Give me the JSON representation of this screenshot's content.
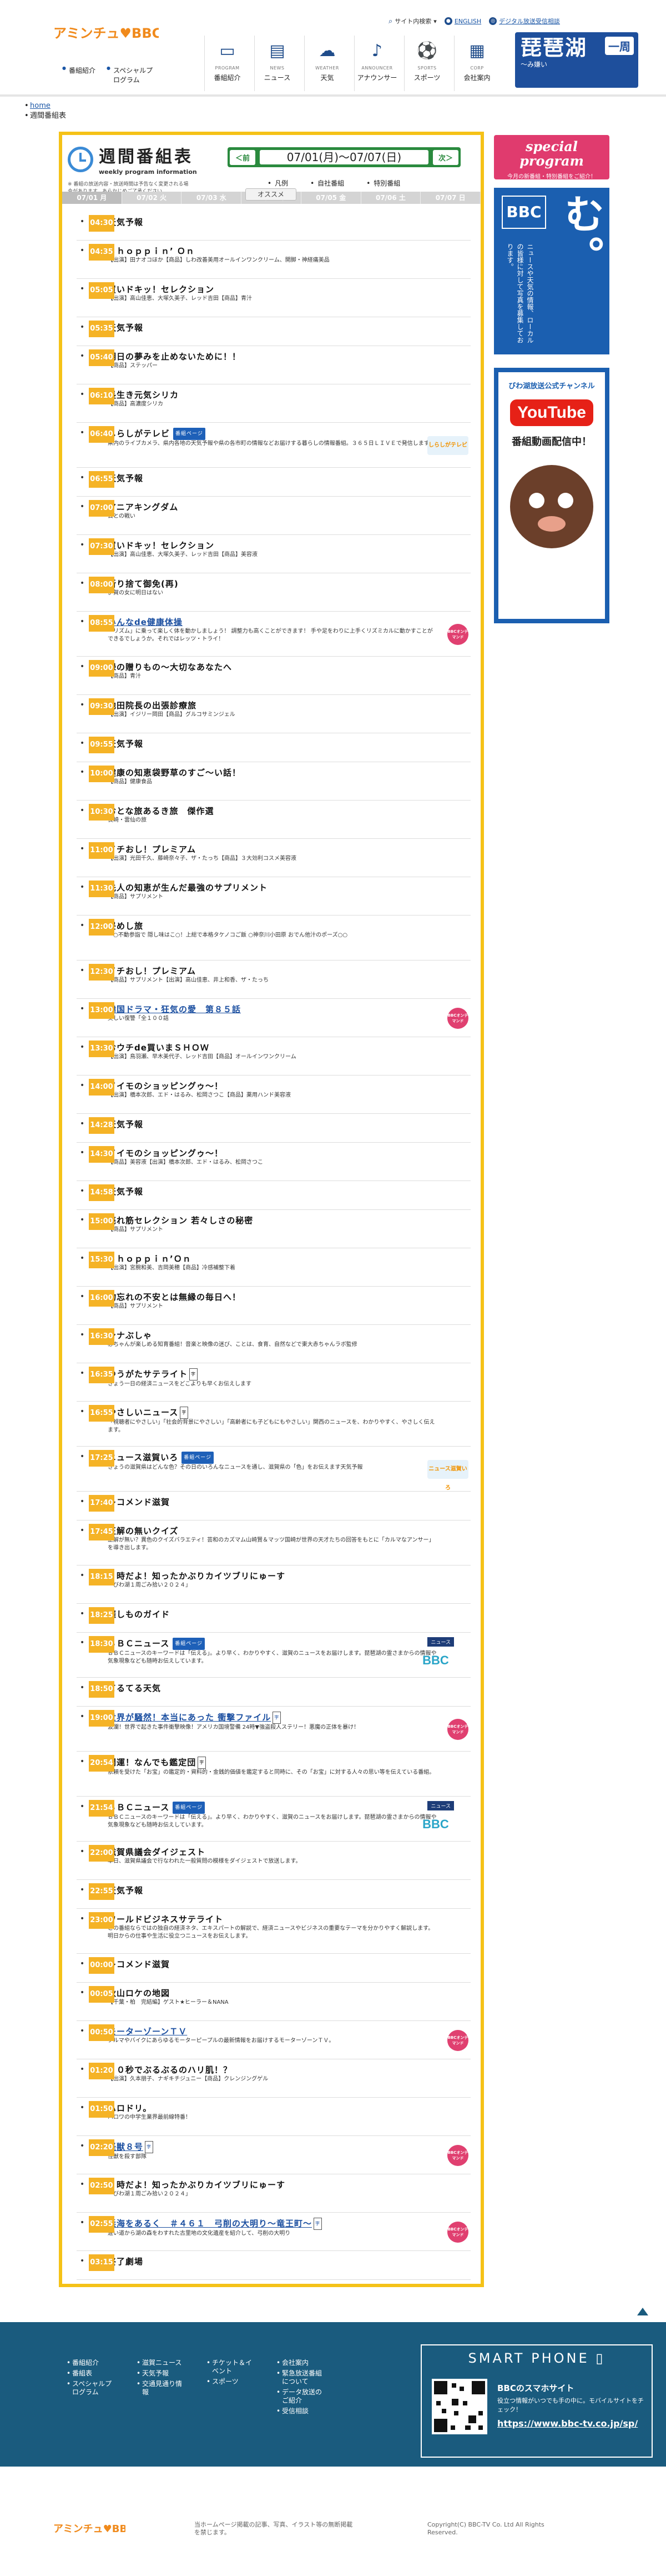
{
  "header": {
    "logo_text": "アミンチュ♥BBC",
    "util": {
      "site_search": "サイト内検索",
      "english": "ENGLISH",
      "digital": "デジタル放送受信相談"
    },
    "sub_links": [
      "番組紹介",
      "スペシャルプログラム"
    ],
    "nav": [
      {
        "en": "PROGRAM",
        "jp": "番組紹介",
        "icon": "tv-icon"
      },
      {
        "en": "NEWS",
        "jp": "ニュース",
        "icon": "news-icon"
      },
      {
        "en": "WEATHER",
        "jp": "天気",
        "icon": "weather-icon"
      },
      {
        "en": "ANNOUNCER",
        "jp": "アナウンサー",
        "icon": "microphone-icon"
      },
      {
        "en": "SPORTS",
        "jp": "スポーツ",
        "icon": "sports-icon"
      },
      {
        "en": "CORP",
        "jp": "会社案内",
        "icon": "building-icon"
      }
    ],
    "banner": {
      "title": "琵琶湖",
      "badge": "一周",
      "sub": "〜み嫌い"
    }
  },
  "breadcrumb": {
    "home": "home",
    "current": "週間番組表"
  },
  "schedule": {
    "title_jp": "週間番組表",
    "title_en": "weekly program information",
    "note": "※ 番組の放送内容・放送時間は予告なく変更される場合があります。あらかじめご了承ください。",
    "prev": "＜前",
    "next": "次＞",
    "range": "07/01(月)〜07/07(日)",
    "legend": [
      "凡例",
      "自社番組",
      "特別番組"
    ],
    "recommend": "オススメ",
    "days": [
      "07/01 月",
      "07/02 火",
      "07/03 水",
      "07/04 木",
      "07/05 金",
      "07/06 土",
      "07/07 日"
    ],
    "page_badge": "番組ページ",
    "news_badge": "ニュース",
    "ondemand": "BBCオンデマンド",
    "programs": [
      {
        "time": "04:30",
        "title": "天気予報",
        "desc": ""
      },
      {
        "time": "04:35",
        "title": "Ｓｈｏｐｐｉｎ’ Ｏｎ",
        "desc": "【出演】田ナオコほか【商品】しわ改善美用オールインワンクリーム、開脚・神経痛美品"
      },
      {
        "time": "05:05",
        "title": "買いドキッ！セレクション",
        "desc": "【出演】高山佳恵、大塚久美子、レッド吉田【商品】青汁"
      },
      {
        "time": "05:35",
        "title": "天気予報",
        "desc": ""
      },
      {
        "time": "05:40",
        "title": "明日の夢みを止めないために！！",
        "desc": "【商品】ステッパー"
      },
      {
        "time": "06:10",
        "title": "長生き元気シリカ",
        "desc": "【商品】高濃度シリカ"
      },
      {
        "time": "06:40",
        "title": "しらしがテレビ",
        "desc": "県内のライブカメラ、県内各地の天気予報や県の各市町の情報などお届けする暮らしの情報番組。３６５日ＬＩＶＥで発信します。",
        "page": true
      },
      {
        "time": "06:55",
        "title": "天気予報",
        "desc": ""
      },
      {
        "time": "07:00",
        "title": "アニアキングダム",
        "desc": "去との戦い"
      },
      {
        "time": "07:30",
        "title": "買いドキッ！セレクション",
        "desc": "【出演】高山佳恵、大塚久美子、レッド吉田【商品】美容液"
      },
      {
        "time": "08:00",
        "title": "新り捨て御免(再)",
        "desc": "伊賀の女に明日はない"
      },
      {
        "time": "08:55",
        "title": "みんなde健康体操",
        "desc": "「リズム」に乗って楽しく体を動かしましょう！ 調整力も高くことができます！ 手や足をわりに上手くリズミカルに動かすことができるでしょうか。それではレッツ・トライ！",
        "link": true,
        "ondemand": true
      },
      {
        "time": "09:00",
        "title": "緑の贈りもの〜大切なあなたへ",
        "desc": "【商品】青汁"
      },
      {
        "time": "09:30",
        "title": "池田院長の出張診療旅",
        "desc": "【出演】イジリー岡田【商品】グルコサミンジェル"
      },
      {
        "time": "09:55",
        "title": "天気予報",
        "desc": ""
      },
      {
        "time": "10:00",
        "title": "健康の知恵袋野草のすご〜い話！",
        "desc": "【商品】健康食品"
      },
      {
        "time": "10:30",
        "title": "おとな旅あるき旅　傑作選",
        "desc": "長崎・雲仙の旅"
      },
      {
        "time": "11:00",
        "title": "イチおし！プレミアム",
        "desc": "【出演】光田千久、藤崎奈々子、ザ・たっち【商品】３大効利コスメ美容液"
      },
      {
        "time": "11:30",
        "title": "先人の知恵が生んだ最強のサプリメント",
        "desc": "【商品】サプリメント"
      },
      {
        "time": "12:00",
        "title": "昼めし旅",
        "desc": "「○不動参詣で 隠し味はこ○！上総で本格タケノコご飯 ○神奈川小田原 おでん他汁のポーズ○○"
      },
      {
        "time": "12:30",
        "title": "イチおし！プレミアム",
        "desc": "【商品】サプリメント【出演】高山佳恵、井上和香、ザ・たっち"
      },
      {
        "time": "13:00",
        "title": "韓国ドラマ・狂気の愛　第８５話",
        "desc": "美しい復讐「全１００話",
        "link": true,
        "ondemand": true
      },
      {
        "time": "13:30",
        "title": "おウチde買いまＳＨＯＷ",
        "desc": "【出演】鳥羽瀬、早木美代子、レッド吉田【商品】オールインワンクリーム"
      },
      {
        "time": "14:00",
        "title": "イイモのショッピングゥ〜！",
        "desc": "【出演】橋本次郎、エド・はるみ、松岡さつこ【商品】薬用ハンド美容液"
      },
      {
        "time": "14:28",
        "title": "天気予報",
        "desc": ""
      },
      {
        "time": "14:30",
        "title": "イイモのショッピングゥ〜！",
        "desc": "【商品】美容液【出演】橋本次郎、エド・はるみ、松岡さつこ"
      },
      {
        "time": "14:58",
        "title": "天気予報",
        "desc": ""
      },
      {
        "time": "15:00",
        "title": "売れ筋セレクション 若々しさの秘密",
        "desc": "【商品】サプリメント"
      },
      {
        "time": "15:30",
        "title": "Ｓｈｏｐｐｉｎ’Ｏｎ",
        "desc": "【出演】宮腕和美、吉岡美穂【商品】冷感補整下着"
      },
      {
        "time": "16:00",
        "title": "物忘れの不安とは無縁の毎日へ！",
        "desc": "【商品】サプリメント"
      },
      {
        "time": "16:30",
        "title": "シナぶしゃ",
        "desc": "赤ちゃんが楽しめる知育番組！音楽と映像の迷び、ことは、食育、自然などで東大赤ちゃんラボ監修"
      },
      {
        "time": "16:35",
        "title": "ゆうがたサテライト",
        "desc": "きょう一日の経済ニュースをどこよりも早くお伝えします",
        "small": "字"
      },
      {
        "time": "16:55",
        "title": "やさしいニュース",
        "desc": "「視聴者にやさしい」「社会的背景にやさしい」「高齢者にも子どもにもやさしい」関西のニュースを、わかりやすく、やさしく伝えます。",
        "small": "字"
      },
      {
        "time": "17:25",
        "title": "ニュース滋賀いろ",
        "desc": "きょうの滋賀県はどんな色？その日のいろんなニュースを通し、滋賀県の「色」をお伝えます天気予報",
        "page": true,
        "thumb": "ニュース滋賀いろ"
      },
      {
        "time": "17:40",
        "title": "レコメンド滋賀",
        "desc": ""
      },
      {
        "time": "17:45",
        "title": "正解の無いクイズ",
        "desc": "正解が無い？異色のクイズバラエティ！芸和のカズマム山崎賢＆マッツ国崎が世界の天才たちの回答をもとに「カルマなアンサー」を導き出します。"
      },
      {
        "time": "18:15",
        "title": "６時だよ！知ったかぶりカイツブリにゅーす",
        "desc": "「びわ湖１周ごみ拾い２０２４」"
      },
      {
        "time": "18:25",
        "title": "催しものガイド",
        "desc": ""
      },
      {
        "time": "18:30",
        "title": "ＢＢＣニュース",
        "desc": "ＢＢＣニュースのキーワードは「伝える」。より早く、わかりやすく、滋賀のニュースをお届けします。琵琶湖の霊さまからの情報や気象現象なども随時お伝えしています。",
        "page": true,
        "news": true,
        "bbc": true
      },
      {
        "time": "18:50",
        "title": "てるてる天気",
        "desc": ""
      },
      {
        "time": "19:00",
        "title": "世界が騒然！本当にあった 衝撃ファイル",
        "desc": "波瀾！世界で起きた事件衝撃映像！アメリカ国境警備 24時▼強盗殺人ステリー！悪魔の正体を暴け！",
        "link": true,
        "small": "字",
        "ondemand": true
      },
      {
        "time": "20:54",
        "title": "開運！なんでも鑑定団",
        "desc": "依頼を受けた「お宝」の鑑定的・資料的・金銭的価値を鑑定すると同時に、その「お宝」に対する人々の思い等を伝えている番組。",
        "small": "字"
      },
      {
        "time": "21:54",
        "title": "ＢＢＣニュース",
        "desc": "ＢＢＣニュースのキーワードは「伝える」。より早く、わかりやすく、滋賀のニュースをお届けします。琵琶湖の霊さまからの情報や気象現象なども随時お伝えしています。",
        "page": true,
        "news": true,
        "bbc": true
      },
      {
        "time": "22:00",
        "title": "滋賀県議会ダイジェスト",
        "desc": "本日、滋賀県議会で行なわれた一般質問の模様をダイジェストで放送します。"
      },
      {
        "time": "22:55",
        "title": "天気予報",
        "desc": ""
      },
      {
        "time": "23:00",
        "title": "ワールドビジネスサテライト",
        "desc": "この番組ならではの独自の経済ネタ、エキスパートの解説で、経済ニュースやビジネスの重要なテーマを分かりやすく解説します。明日からの仕事や生活に役立つニュースをお伝えします。"
      },
      {
        "time": "00:00",
        "title": "レコメンド滋賀",
        "desc": ""
      },
      {
        "time": "00:05",
        "title": "秋山ロケの地図",
        "desc": "【千葉・柏　完結編】ゲスト★ヒーラー＆NANA"
      },
      {
        "time": "00:50",
        "title": "モーターゾーンＴＶ",
        "desc": "クルマやバイクにあらゆるモーターピープルの最新情報をお届けするモーターゾーンＴＶ。",
        "link": true,
        "ondemand": true
      },
      {
        "time": "01:20",
        "title": "６０秒でぶるぶるのハリ肌！？",
        "desc": "【出演】久本朋子、ナギキチジュニー【商品】クレンジングゲル"
      },
      {
        "time": "01:50",
        "title": "ハロドリ。",
        "desc": "ハロワの中学生業界最前線特番！"
      },
      {
        "time": "02:20",
        "title": "怪獣８号",
        "desc": "怪獣を殺す部隊",
        "link": true,
        "small": "字",
        "ondemand": true
      },
      {
        "time": "02:50",
        "title": "６時だよ！知ったかぶりカイツブリにゅーす",
        "desc": "「びわ湖１周ごみ拾い２０２４」"
      },
      {
        "time": "02:55",
        "title": "浜海をあるく　＃４６１　弓削の大明り〜竜王町〜",
        "desc": "違い道から湖の森をわすれた古里地の文化遺産を紹介して、弓削の大明り",
        "link": true,
        "small": "字",
        "ondemand": true
      },
      {
        "time": "03:15",
        "title": "終了劇場",
        "desc": ""
      }
    ]
  },
  "side": {
    "special_title": "special program",
    "special_sub": "今月の新番組・特別番組をご紹介！",
    "photo_big": "写真求む。",
    "photo_badge": "BBC",
    "photo_sub": "ニュースや天気の情報、ローカルの皆様に対して写真を募集しております。",
    "yt_top": "びわ湖放送公式チャンネル",
    "yt_logo": "YouTube",
    "yt_sub": "番組動画配信中！"
  },
  "footer": {
    "cols": [
      [
        "番組紹介",
        "番組表",
        "スペシャルプログラム"
      ],
      [
        "滋賀ニュース",
        "天気予報",
        "交通見通り情報"
      ],
      [
        "チケット＆イベント",
        "スポーツ"
      ],
      [
        "会社案内",
        "緊急放送番組について",
        "データ放送のご紹介",
        "受信相談"
      ]
    ],
    "sp_head": "SMART PHONE",
    "sp_title": "BBCのスマホサイト",
    "sp_desc": "役立つ情報がいつでも手の中に。モバイルサイトをチェック！",
    "sp_url": "https://www.bbc-tv.co.jp/sp/",
    "copy1": "当ホームページ掲載の記事、写真、イラスト等の無断掲載を禁じます。",
    "copy2": "Copyright(C) BBC-TV Co. Ltd All Rights Reserved."
  }
}
